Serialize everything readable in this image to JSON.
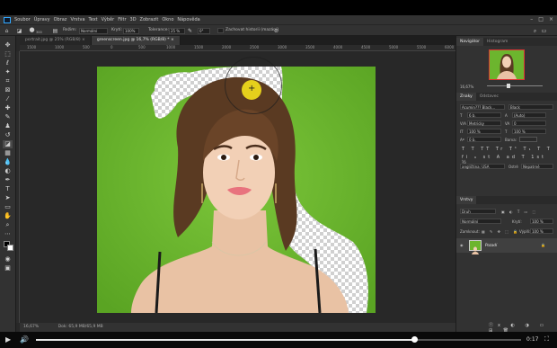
{
  "menu": {
    "items": [
      "Soubor",
      "Úpravy",
      "Obraz",
      "Vrstva",
      "Text",
      "Výběr",
      "Filtr",
      "3D",
      "Zobrazit",
      "Okno",
      "Nápověda"
    ]
  },
  "options_bar": {
    "mode_label": "Režim:",
    "mode_value": "Normální",
    "opacity_label": "Krytí:",
    "opacity_value": "100%",
    "tolerance_label": "Tolerance:",
    "tolerance_value": "25 %",
    "angle_value": "0°",
    "erase_history_label": "Zachovat historii (mazání)",
    "brush_size": "300"
  },
  "tabs": [
    {
      "label": "portrait.jpg @ 25% (RGB/8)",
      "active": false
    },
    {
      "label": "greenscreen.jpg @ 16,7% (RGB/8) *",
      "active": true
    }
  ],
  "ruler_labels": [
    "1500",
    "1000",
    "500",
    "0",
    "500",
    "1000",
    "1500",
    "2000",
    "2500",
    "3000",
    "3500",
    "4000",
    "4500",
    "5000",
    "5500",
    "6000"
  ],
  "status": {
    "zoom": "16,67%",
    "doc": "Dok: 65,9 MB/65,9 MB"
  },
  "navigator": {
    "tabs": [
      "Navigátor",
      "Histogram"
    ],
    "zoom": "16,67%"
  },
  "character": {
    "tabs": [
      "Znaky",
      "Odstavec"
    ],
    "font_family": "Acumin??? Black...",
    "font_style": "Black",
    "font_size": "6 b.",
    "leading": "(Auto)",
    "kerning": "Metricky",
    "tracking": "0",
    "vscale": "100 %",
    "hscale": "100 %",
    "baseline": "0 b.",
    "color_label": "Barva:",
    "language": "angličtina: USA",
    "aa": "Ostré",
    "aa_value": "Nepatrné"
  },
  "layers": {
    "title": "Vrstvy",
    "search_placeholder": "Druh",
    "blend_mode": "Normální",
    "opacity_label": "Krytí:",
    "opacity_value": "100 %",
    "lock_label": "Zamknout:",
    "fill_label": "Výplň:",
    "fill_value": "100 %",
    "layer_name": "Pozadí"
  },
  "video": {
    "time": "0:17"
  },
  "progress": 0.78,
  "colors": {
    "green": "#6cb52e",
    "accent": "#31a8ff",
    "cursor": "#f4e11c"
  }
}
